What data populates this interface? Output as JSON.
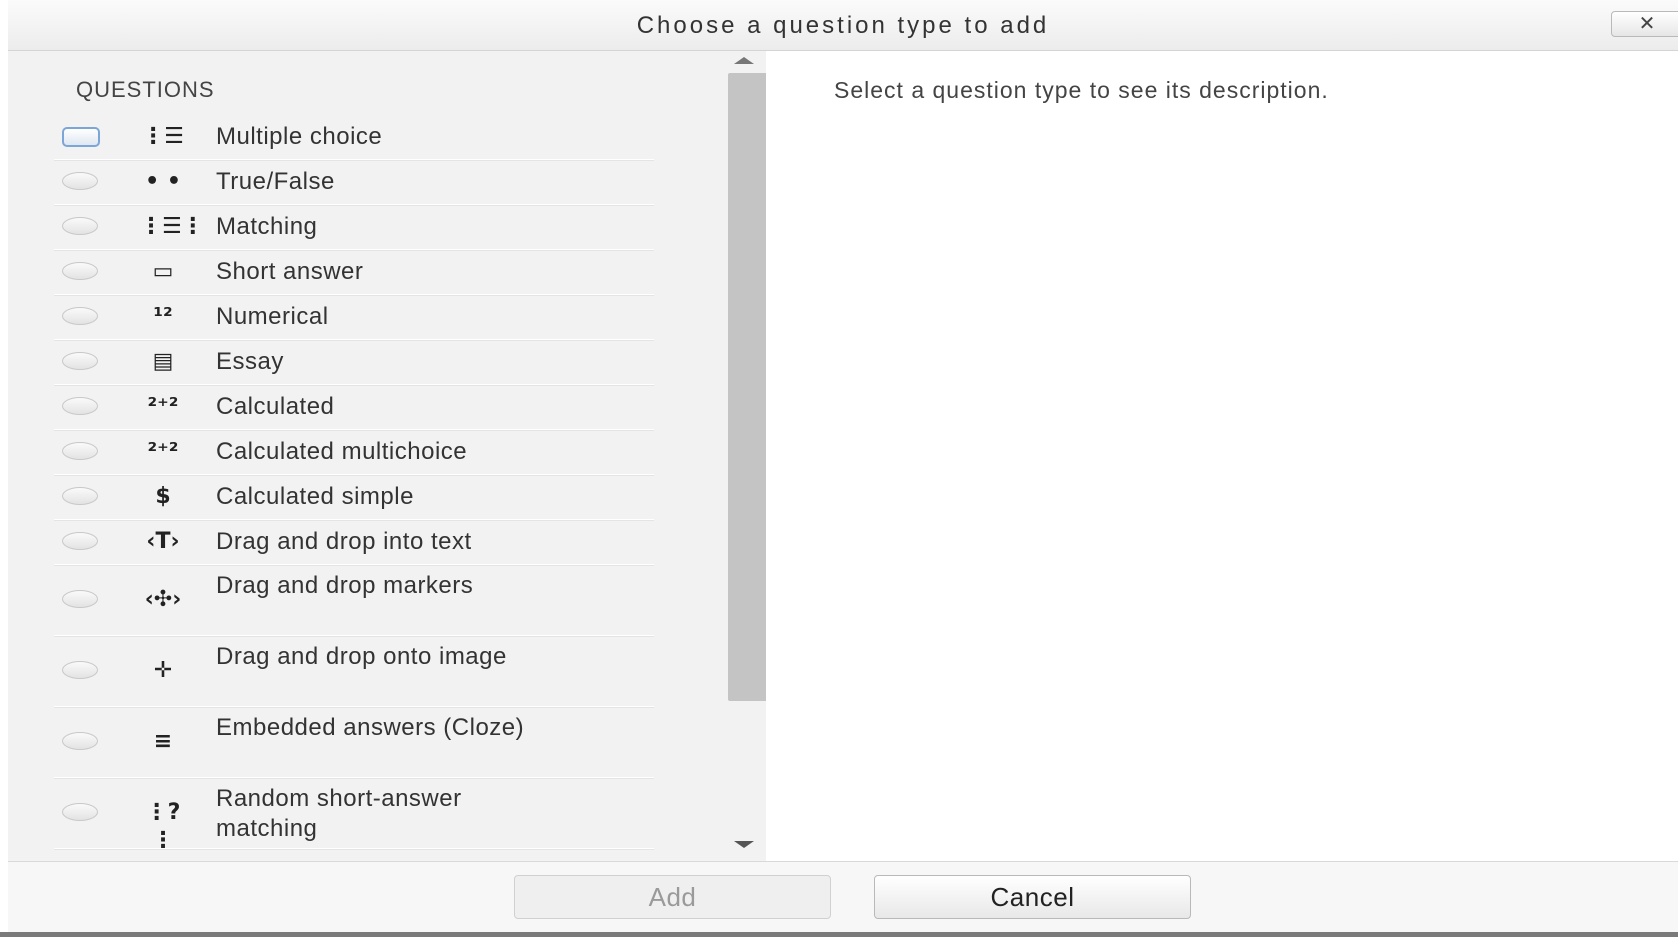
{
  "dialog": {
    "title": "Choose a question type to add",
    "close_glyph": "✕"
  },
  "left_panel": {
    "section_title": "QUESTIONS",
    "items": [
      {
        "label": "Multiple choice",
        "icon": "multiple-choice-icon",
        "glyph": "⋮☰",
        "selected": true
      },
      {
        "label": "True/False",
        "icon": "true-false-icon",
        "glyph": "• •",
        "selected": false
      },
      {
        "label": "Matching",
        "icon": "matching-icon",
        "glyph": "⋮☰⋮",
        "selected": false
      },
      {
        "label": "Short answer",
        "icon": "short-answer-icon",
        "glyph": "▭",
        "selected": false
      },
      {
        "label": "Numerical",
        "icon": "numerical-icon",
        "glyph": "¹²",
        "selected": false
      },
      {
        "label": "Essay",
        "icon": "essay-icon",
        "glyph": "▤",
        "selected": false
      },
      {
        "label": "Calculated",
        "icon": "calculated-icon",
        "glyph": "²⁺²",
        "selected": false
      },
      {
        "label": "Calculated multichoice",
        "icon": "calculated-multichoice-icon",
        "glyph": "²⁺²",
        "selected": false
      },
      {
        "label": "Calculated simple",
        "icon": "calculated-simple-icon",
        "glyph": "$",
        "selected": false
      },
      {
        "label": "Drag and drop into text",
        "icon": "drag-drop-text-icon",
        "glyph": "‹T›",
        "selected": false
      },
      {
        "label": "Drag and drop markers",
        "icon": "drag-drop-markers-icon",
        "glyph": "‹✣›",
        "selected": false
      },
      {
        "label": "Drag and drop onto image",
        "icon": "drag-drop-image-icon",
        "glyph": "✛",
        "selected": false
      },
      {
        "label": "Embedded answers (Cloze)",
        "icon": "embedded-answers-icon",
        "glyph": "≡",
        "selected": false
      },
      {
        "label": "Random short-answer matching",
        "icon": "random-short-answer-icon",
        "glyph": "⋮?⋮",
        "selected": false
      }
    ]
  },
  "right_panel": {
    "description": "Select a question type to see its description."
  },
  "footer": {
    "add_label": "Add",
    "cancel_label": "Cancel"
  }
}
